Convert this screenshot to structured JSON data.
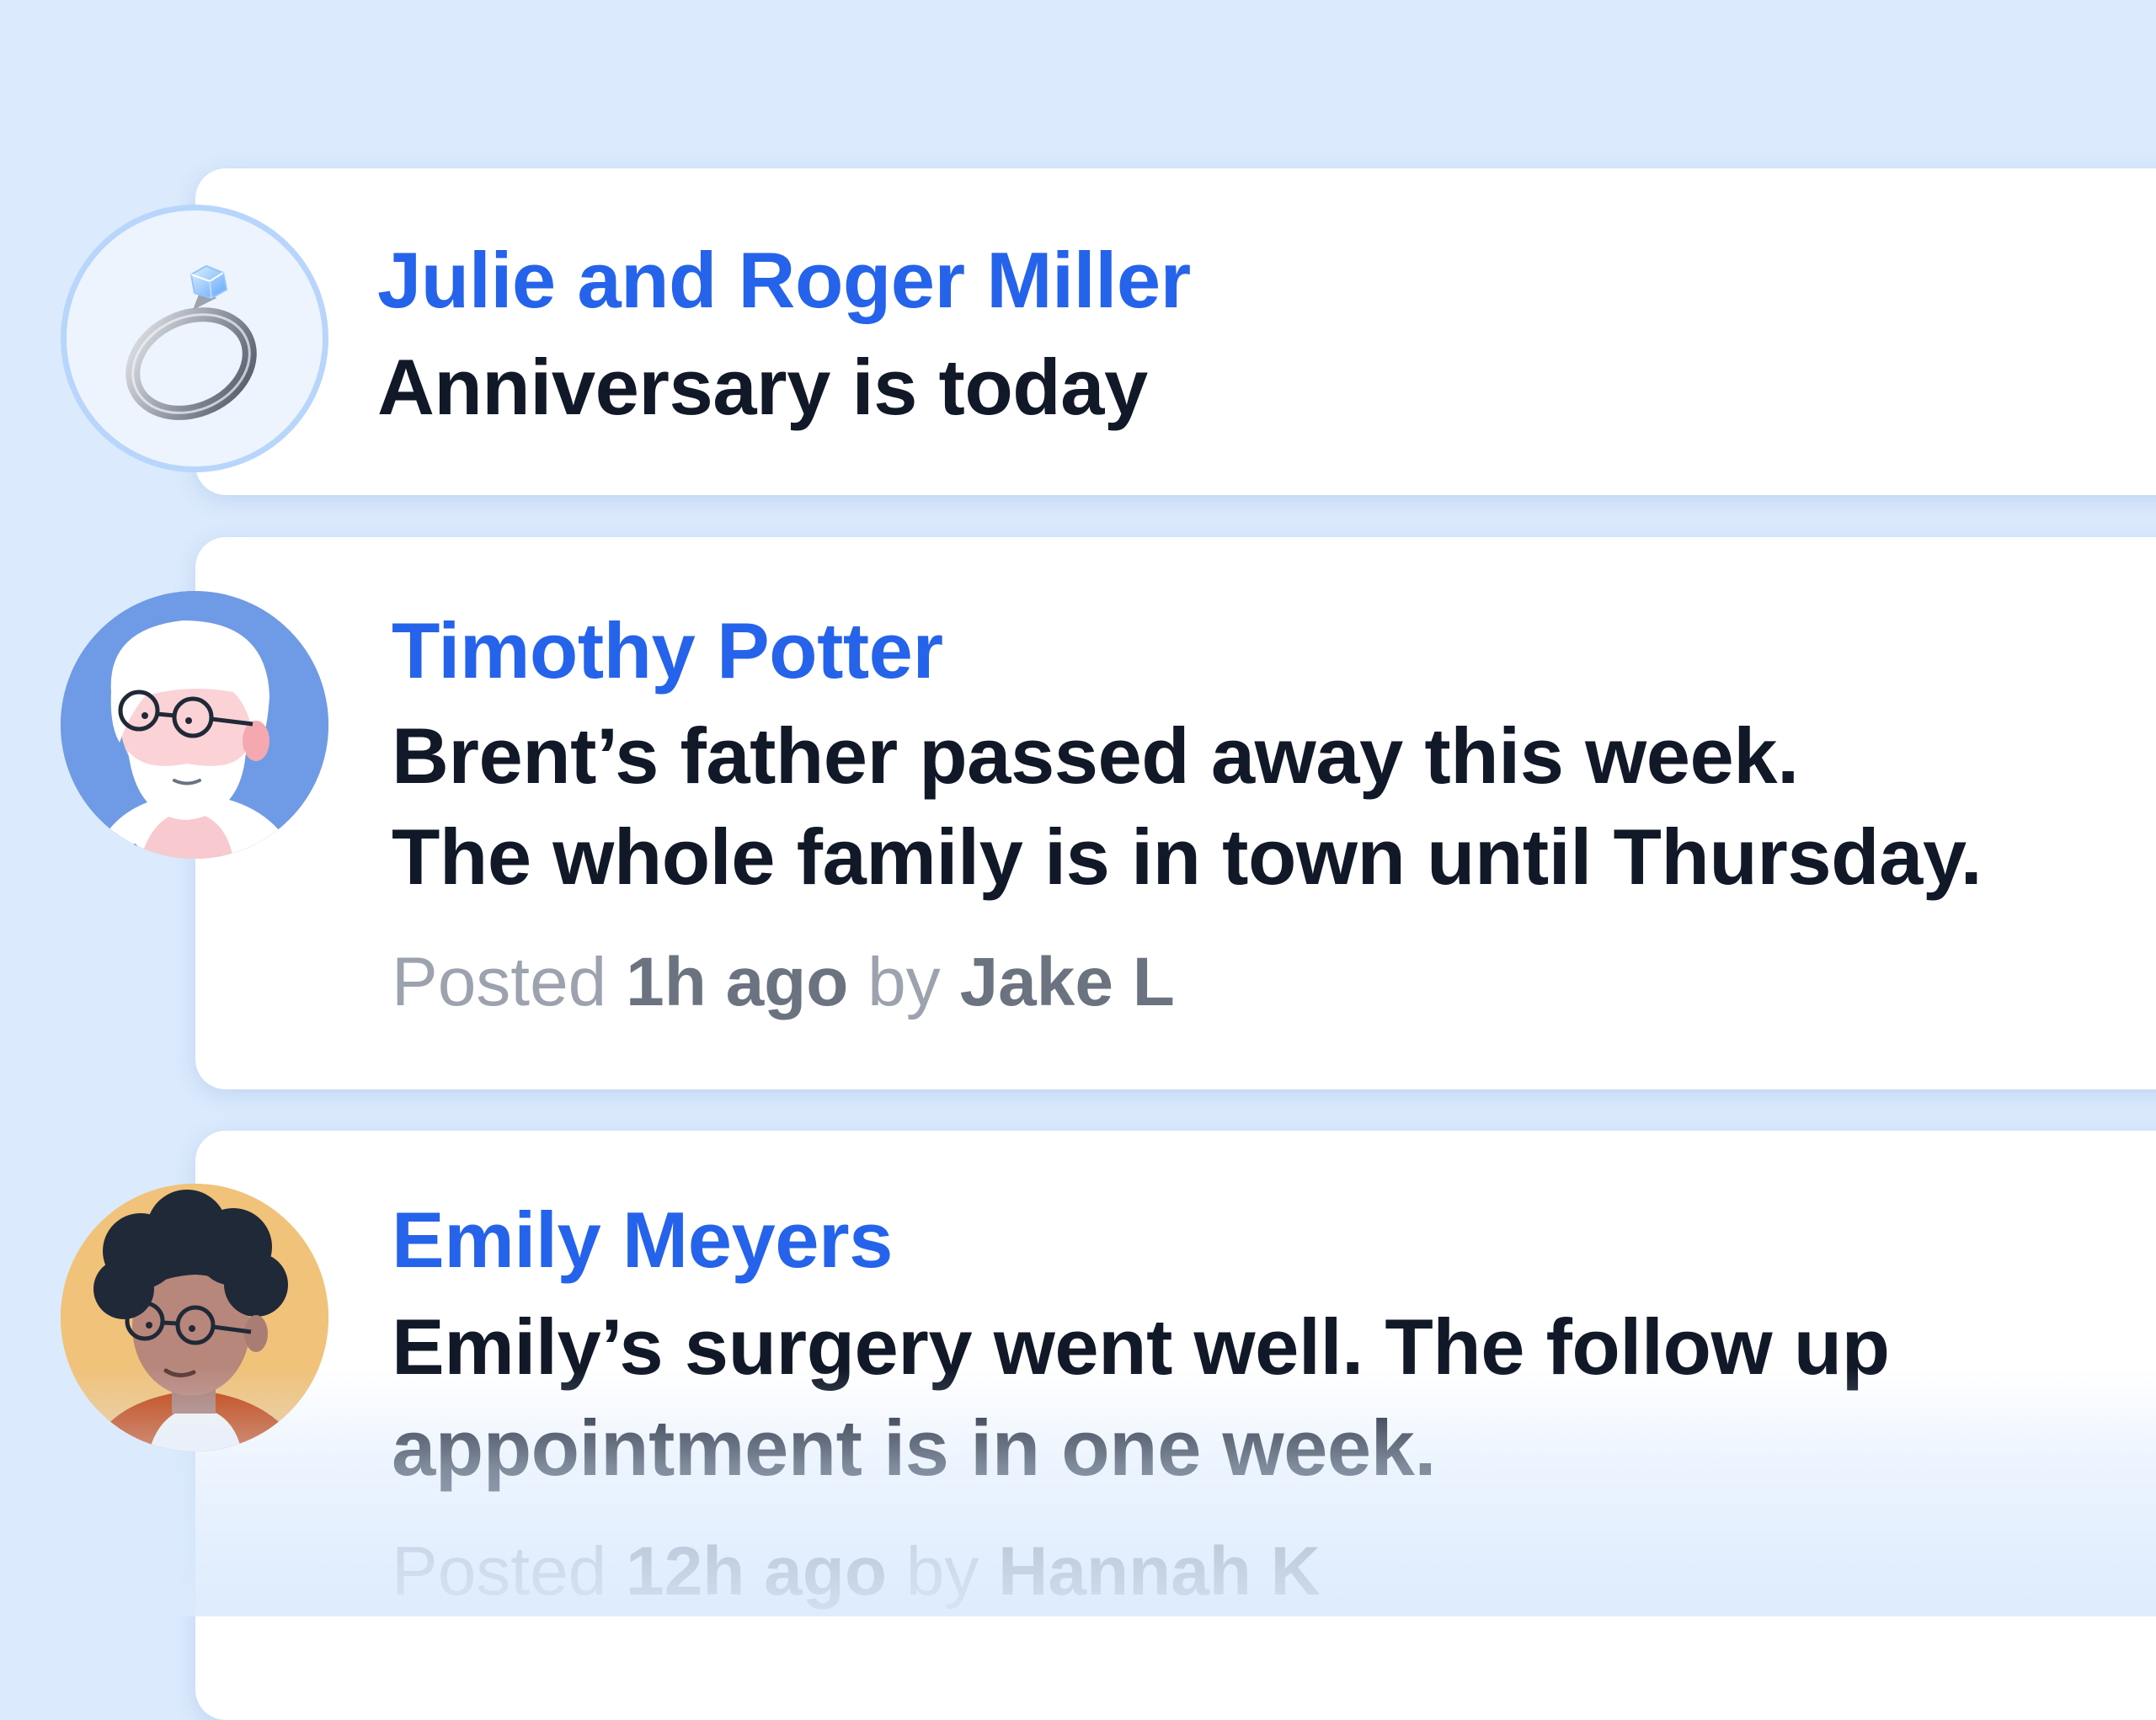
{
  "feed": {
    "items": [
      {
        "avatar_icon": "ring-icon",
        "name": "Julie and Roger Miller",
        "message_lines": [
          "Anniversary is today"
        ]
      },
      {
        "avatar_icon": "elderly-man-avatar",
        "name": "Timothy Potter",
        "message_lines": [
          "Brent’s father passed away this week.",
          "The whole family is in town until Thursday."
        ],
        "meta": {
          "posted_label": "Posted",
          "time": "1h ago",
          "by_label": "by",
          "author": "Jake L"
        }
      },
      {
        "avatar_icon": "woman-avatar",
        "name": "Emily Meyers",
        "message_lines": [
          "Emily’s surgery went well. The follow up",
          "appointment is in one week."
        ],
        "meta": {
          "posted_label": "Posted",
          "time": "12h ago",
          "by_label": "by",
          "author": "Hannah K"
        }
      }
    ]
  },
  "colors": {
    "background": "#dbeafd",
    "card": "#ffffff",
    "name": "#2563eb",
    "message": "#111827",
    "meta_light": "#9ca3af",
    "meta_strong": "#6b7280"
  }
}
